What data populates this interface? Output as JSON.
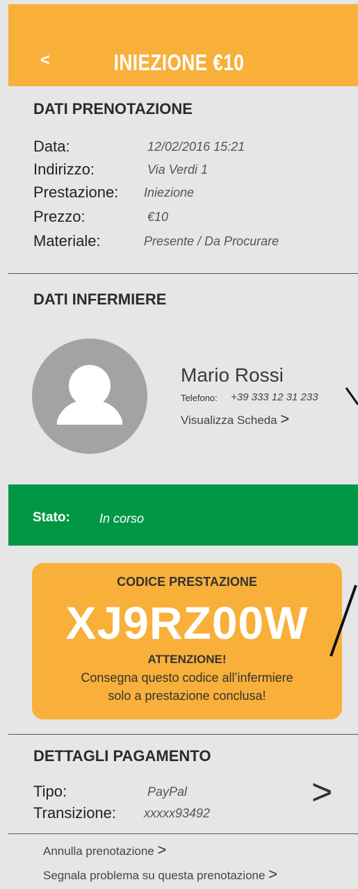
{
  "header": {
    "back_label": "<",
    "title": "INIEZIONE €10"
  },
  "booking": {
    "title": "DATI PRENOTAZIONE",
    "rows": [
      {
        "label": "Data:",
        "value": "12/02/2016   15:21"
      },
      {
        "label": "Indirizzo:",
        "value": "Via Verdi 1"
      },
      {
        "label": "Prestazione:",
        "value": "Iniezione"
      },
      {
        "label": "Prezzo:",
        "value": "€10"
      },
      {
        "label": "Materiale:",
        "value": "Presente / Da Procurare"
      }
    ]
  },
  "nurse": {
    "title": "DATI INFERMIERE",
    "name": "Mario Rossi",
    "phone_label": "Telefono:",
    "phone": "+39 333 12 31 233",
    "view_profile": "Visualizza Scheda",
    "chevron": ">"
  },
  "status": {
    "label": "Stato:",
    "value": "In corso"
  },
  "code": {
    "title": "CODICE PRESTAZIONE",
    "value": "XJ9RZ00W",
    "warning_title": "ATTENZIONE!",
    "warning_line1": "Consegna questo codice all’infermiere",
    "warning_line2": "solo a prestazione conclusa!"
  },
  "payment": {
    "title": "DETTAGLI PAGAMENTO",
    "type_label": "Tipo:",
    "type_value": "PayPal",
    "transaction_label": "Transizione:",
    "transaction_value": "xxxxx93492",
    "chevron": ">"
  },
  "actions": {
    "cancel": "Annulla prenotazione",
    "report": "Segnala problema su questa prenotazione",
    "chevron": ">"
  },
  "colors": {
    "header": "#f8b03a",
    "status": "#009845",
    "card": "#f8b03a",
    "background": "#e6e6e6"
  }
}
